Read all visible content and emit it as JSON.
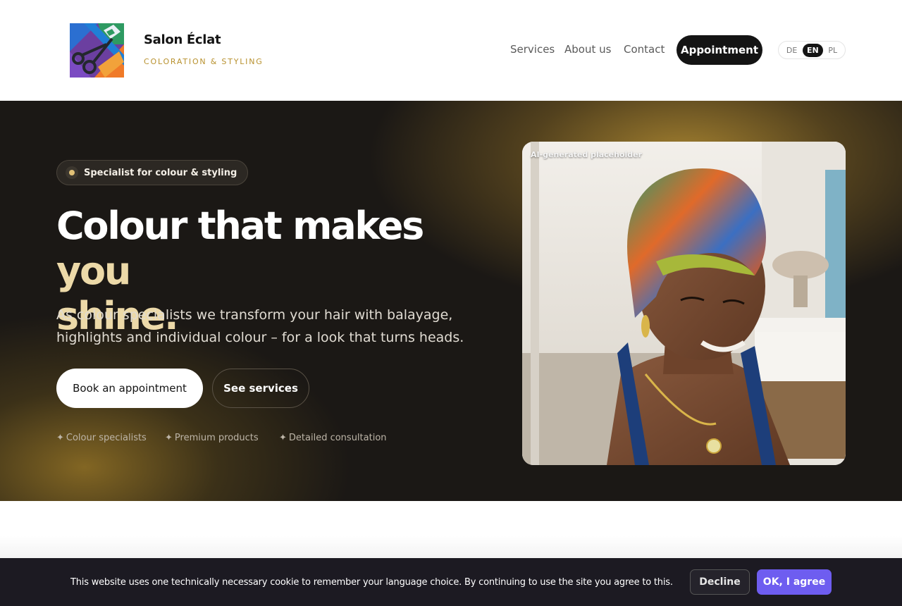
{
  "brand": {
    "name": "Salon Éclat",
    "tagline": "COLORATION & STYLING"
  },
  "nav": {
    "services": "Services",
    "about": "About us",
    "contact": "Contact",
    "appointment": "Appointment"
  },
  "languages": [
    "DE",
    "EN",
    "PL"
  ],
  "active_language": "EN",
  "hero": {
    "pill": "Specialist for colour & styling",
    "headline_white": "Colour that makes ",
    "headline_gold_1": "you",
    "headline_gold_2": "shine.",
    "lede": "As colour specialists we transform your hair with balayage, highlights and individual colour – for a look that turns heads.",
    "book_button": "Book an appointment",
    "services_button": "See services",
    "features": [
      "Colour specialists",
      "Premium products",
      "Detailed consultation"
    ],
    "feature_icon": "✦",
    "photo_label": "AI-generated placeholder"
  },
  "cookie": {
    "text": "This website uses one technically necessary cookie to remember your language choice. By continuing to use the site you agree to this.",
    "decline": "Decline",
    "agree": "OK, I agree"
  },
  "colors": {
    "accent_gold": "#b8912e",
    "hero_bg": "#1b1815",
    "agree_button": "#6e5df0"
  }
}
